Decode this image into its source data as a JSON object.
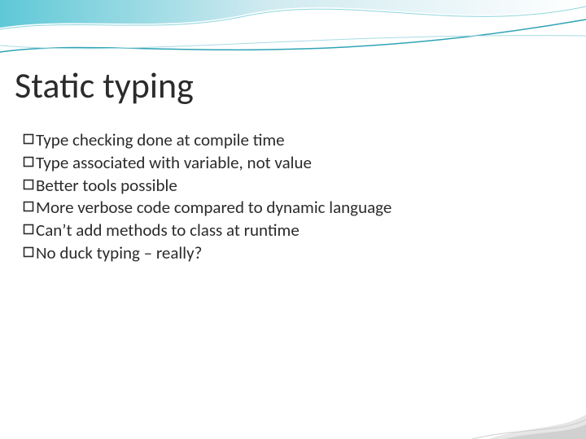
{
  "title": "Static typing",
  "bullets": [
    {
      "text": "Type checking done at compile time"
    },
    {
      "text": "Type associated with variable, not value"
    },
    {
      "text": "Better tools possible"
    },
    {
      "text": "More verbose code compared to dynamic language"
    },
    {
      "text": "Can’t add methods to class at runtime"
    },
    {
      "text": "No duck typing – really?"
    }
  ]
}
